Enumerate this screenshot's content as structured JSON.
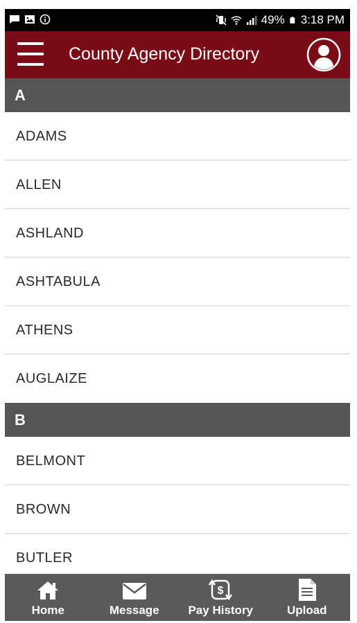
{
  "status_bar": {
    "battery": "49%",
    "time": "3:18 PM",
    "left_icons": [
      "chat-icon",
      "image-icon",
      "info-circle-icon"
    ],
    "right_icons": [
      "vibrate-icon",
      "wifi-icon",
      "signal-icon",
      "battery-icon"
    ]
  },
  "app_bar": {
    "title": "County Agency Directory",
    "background_color": "#7a0c17",
    "menu_icon": "hamburger-menu-icon",
    "profile_icon": "user-avatar-icon"
  },
  "directory": {
    "sections": [
      {
        "letter": "A",
        "items": [
          "ADAMS",
          "ALLEN",
          "ASHLAND",
          "ASHTABULA",
          "ATHENS",
          "AUGLAIZE"
        ]
      },
      {
        "letter": "B",
        "items": [
          "BELMONT",
          "BROWN",
          "BUTLER"
        ]
      }
    ]
  },
  "bottom_nav": {
    "items": [
      {
        "label": "Home",
        "icon": "home-icon"
      },
      {
        "label": "Message",
        "icon": "envelope-icon"
      },
      {
        "label": "Pay History",
        "icon": "pay-history-icon"
      },
      {
        "label": "Upload",
        "icon": "document-icon"
      }
    ]
  }
}
